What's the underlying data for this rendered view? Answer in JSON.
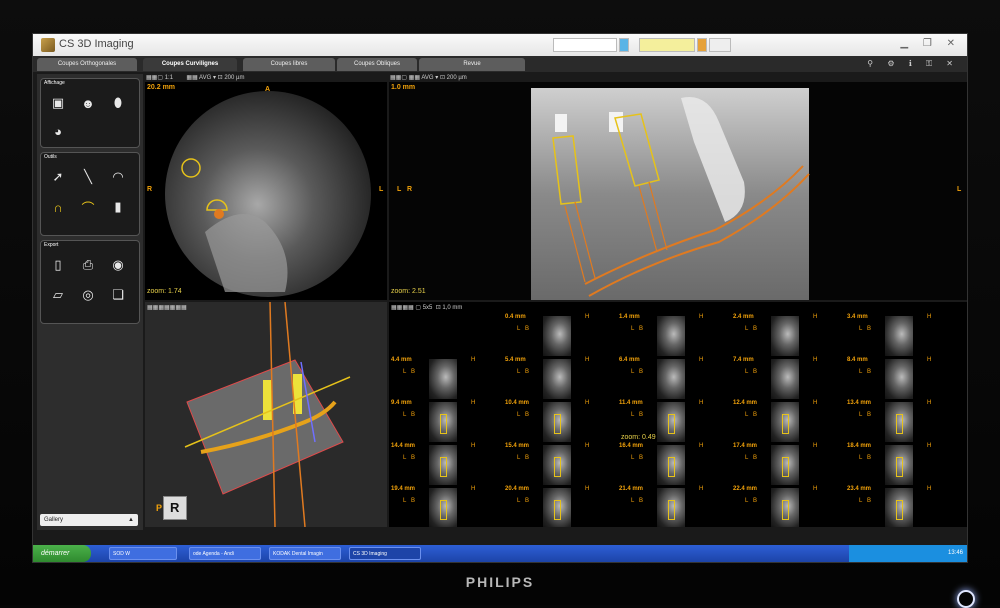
{
  "app": {
    "title": "CS 3D Imaging"
  },
  "tabs": [
    {
      "label": "Coupes Orthogonales",
      "active": false
    },
    {
      "label": "Coupes Curvilignes",
      "active": true
    },
    {
      "label": "Coupes libres",
      "active": false
    },
    {
      "label": "Coupes Obliques",
      "active": false
    },
    {
      "label": "Revue",
      "active": false
    }
  ],
  "sidebar": {
    "display_title": "Affichage",
    "tools_title": "Outils",
    "export_title": "Export",
    "gallery_label": "Gallery"
  },
  "toolbar": {
    "ratio": "1:1",
    "filter": "AVG",
    "thickness": "200 µm",
    "thickness2": "1,0 mm",
    "grid": "5x5"
  },
  "views": {
    "axial": {
      "mm": "20.2 mm",
      "zoom": "zoom: 1.74",
      "top": "A",
      "left": "R",
      "right": "L"
    },
    "panoramic": {
      "mm": "1.0 mm",
      "zoom": "zoom: 2.51",
      "side_l": "L",
      "side_r": "R",
      "edge": "L"
    },
    "slices": {
      "zoom": "zoom: 0.49"
    }
  },
  "slices": [
    {
      "mm": "0.4 mm"
    },
    {
      "mm": "1.4 mm"
    },
    {
      "mm": "2.4 mm"
    },
    {
      "mm": "3.4 mm"
    },
    {
      "mm": "4.4 mm"
    },
    {
      "mm": "5.4 mm"
    },
    {
      "mm": "6.4 mm"
    },
    {
      "mm": "7.4 mm"
    },
    {
      "mm": "8.4 mm"
    },
    {
      "mm": "9.4 mm"
    },
    {
      "mm": "10.4 mm"
    },
    {
      "mm": "11.4 mm"
    },
    {
      "mm": "12.4 mm"
    },
    {
      "mm": "13.4 mm"
    },
    {
      "mm": "14.4 mm"
    },
    {
      "mm": "15.4 mm"
    },
    {
      "mm": "16.4 mm"
    },
    {
      "mm": "17.4 mm"
    },
    {
      "mm": "18.4 mm"
    },
    {
      "mm": "19.4 mm"
    },
    {
      "mm": "20.4 mm"
    },
    {
      "mm": "21.4 mm"
    },
    {
      "mm": "22.4 mm"
    },
    {
      "mm": "23.4 mm"
    }
  ],
  "orientation_labels": {
    "h": "H",
    "b": "B",
    "l": "L"
  },
  "cube": {
    "p": "P",
    "r": "R"
  },
  "taskbar": {
    "start": "démarrer",
    "tasks": [
      "SOD W",
      "ode Agenda - Andi",
      "KODAK Dental Imagin",
      "CS 3D Imaging"
    ],
    "clock": "13:46"
  },
  "monitor": {
    "brand": "PHILIPS"
  },
  "colors": {
    "accent": "#f2a20a",
    "implant": "#e6c21a",
    "nerve": "#e07a20",
    "taskbar": "#2d5fd6"
  }
}
